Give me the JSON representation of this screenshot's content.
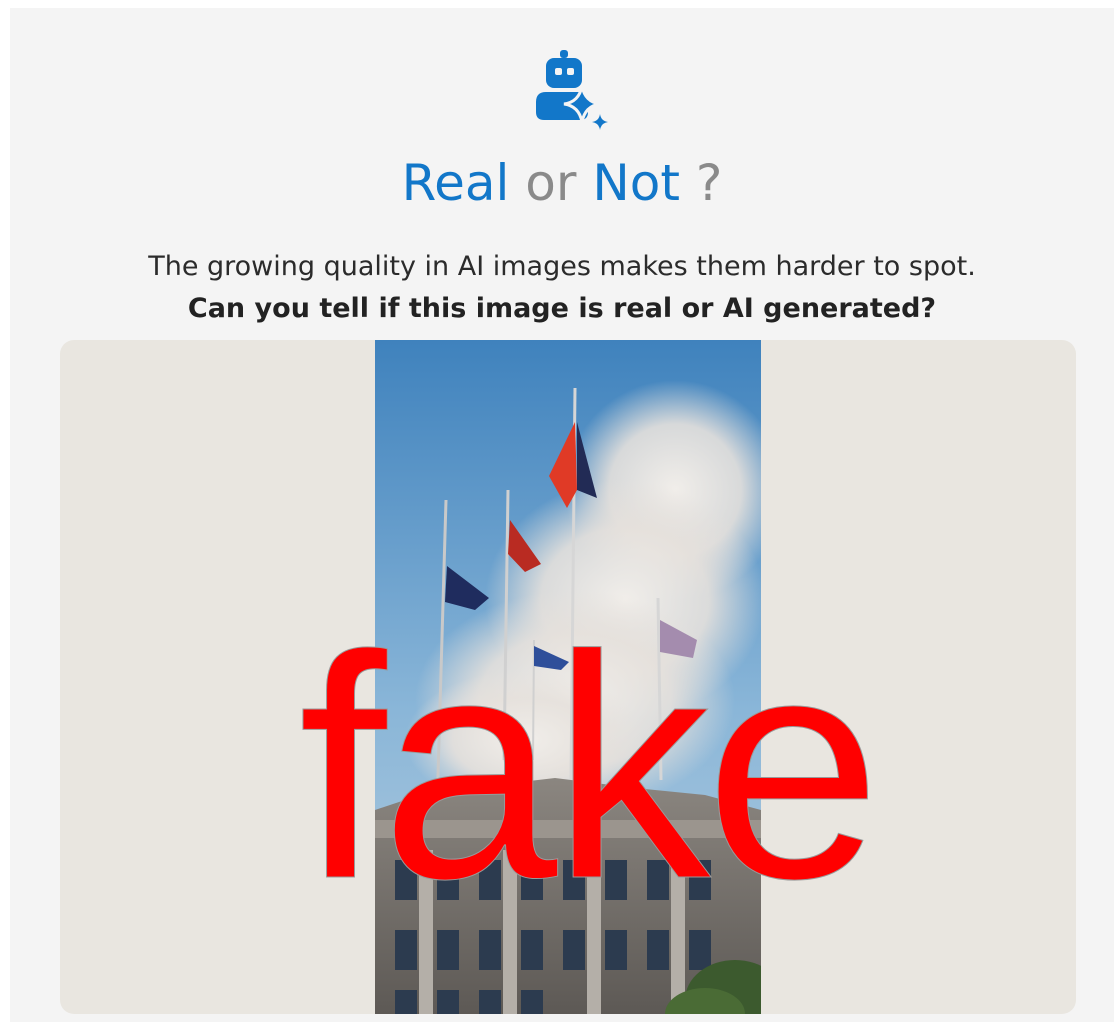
{
  "header": {
    "logo_icon": "robot-sparkle-icon",
    "title_word1": "Real",
    "title_word2": "or",
    "title_word3": "Not",
    "title_word4": "?",
    "accent_color": "#1277c9"
  },
  "intro": {
    "line1": "The growing quality in AI images makes them harder to spot.",
    "line2": "Can you tell if this image is real or AI generated?"
  },
  "image": {
    "stamp_text": "fake",
    "stamp_color": "#ff0000"
  }
}
